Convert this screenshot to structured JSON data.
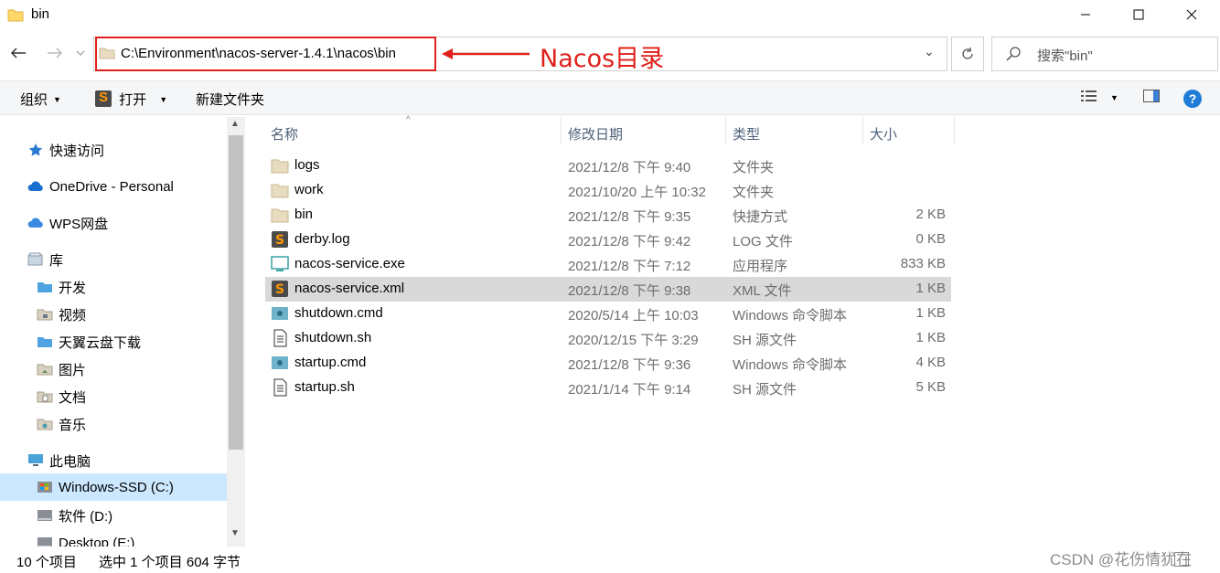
{
  "window": {
    "title": "bin"
  },
  "address": {
    "path": "C:\\Environment\\nacos-server-1.4.1\\nacos\\bin",
    "annotation": "Nacos目录"
  },
  "search": {
    "placeholder": "搜索\"bin\""
  },
  "toolbar": {
    "organize": "组织",
    "open": "打开",
    "new_folder": "新建文件夹"
  },
  "sidebar": {
    "quick_access": "快速访问",
    "onedrive": "OneDrive - Personal",
    "wps": "WPS网盘",
    "library": "库",
    "library_items": [
      "开发",
      "视频",
      "天翼云盘下载",
      "图片",
      "文档",
      "音乐"
    ],
    "this_pc": "此电脑",
    "drives": [
      "Windows-SSD (C:)",
      "软件 (D:)",
      "Desktop (E:)"
    ]
  },
  "columns": {
    "name": "名称",
    "date": "修改日期",
    "type": "类型",
    "size": "大小"
  },
  "files": [
    {
      "name": "logs",
      "date": "2021/12/8 下午 9:40",
      "type": "文件夹",
      "size": "",
      "icon": "folder-icon"
    },
    {
      "name": "work",
      "date": "2021/10/20 上午 10:32",
      "type": "文件夹",
      "size": "",
      "icon": "folder-icon"
    },
    {
      "name": "bin",
      "date": "2021/12/8 下午 9:35",
      "type": "快捷方式",
      "size": "2 KB",
      "icon": "shortcut-icon"
    },
    {
      "name": "derby.log",
      "date": "2021/12/8 下午 9:42",
      "type": "LOG 文件",
      "size": "0 KB",
      "icon": "sublime-icon"
    },
    {
      "name": "nacos-service.exe",
      "date": "2021/12/8 下午 7:12",
      "type": "应用程序",
      "size": "833 KB",
      "icon": "exe-icon"
    },
    {
      "name": "nacos-service.xml",
      "date": "2021/12/8 下午 9:38",
      "type": "XML 文件",
      "size": "1 KB",
      "icon": "sublime-icon",
      "selected": true
    },
    {
      "name": "shutdown.cmd",
      "date": "2020/5/14 上午 10:03",
      "type": "Windows 命令脚本",
      "size": "1 KB",
      "icon": "cmd-icon"
    },
    {
      "name": "shutdown.sh",
      "date": "2020/12/15 下午 3:29",
      "type": "SH 源文件",
      "size": "1 KB",
      "icon": "doc-icon"
    },
    {
      "name": "startup.cmd",
      "date": "2021/12/8 下午 9:36",
      "type": "Windows 命令脚本",
      "size": "4 KB",
      "icon": "cmd-icon"
    },
    {
      "name": "startup.sh",
      "date": "2021/1/14 下午 9:14",
      "type": "SH 源文件",
      "size": "5 KB",
      "icon": "doc-icon"
    }
  ],
  "status": {
    "count": "10 个项目",
    "selection": "选中 1 个项目  604 字节"
  },
  "watermark": "CSDN @花伤情犹在",
  "colors": {
    "highlight_red": "#e0201a",
    "selected_row": "#d9d9d9",
    "selected_nav": "#cce8ff"
  }
}
